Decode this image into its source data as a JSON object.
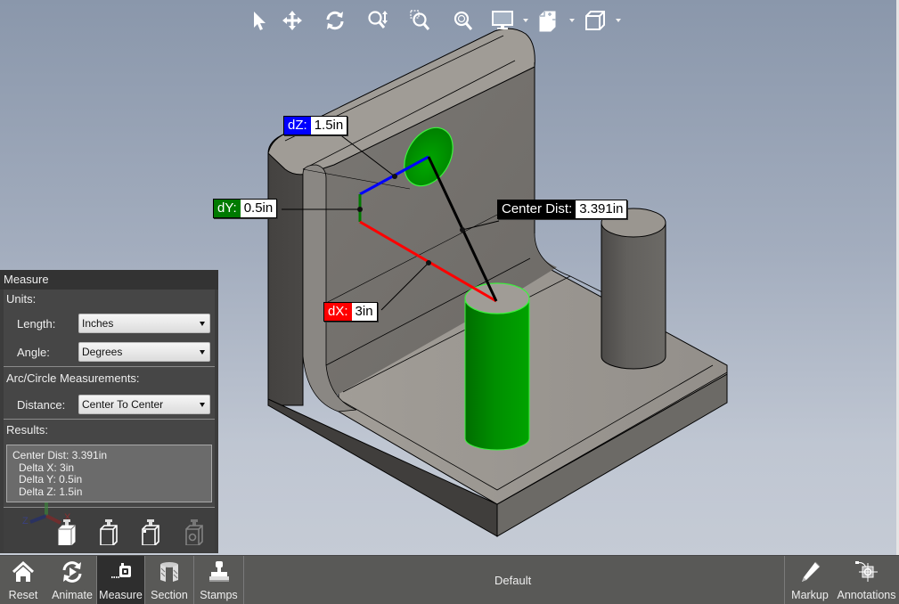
{
  "toolbar": {
    "items": [
      {
        "name": "select-tool",
        "icon": "cursor-arrow-icon"
      },
      {
        "name": "pan-tool",
        "icon": "move-arrows-icon"
      },
      {
        "name": "rotate-tool",
        "icon": "rotate-icon"
      },
      {
        "name": "zoom-tool",
        "icon": "zoom-updown-icon"
      },
      {
        "name": "zoom-window-tool",
        "icon": "zoom-window-icon"
      },
      {
        "name": "zoom-fit-tool",
        "icon": "zoom-fit-icon"
      },
      {
        "name": "display-mode-dropdown",
        "icon": "monitor-icon",
        "has_dropdown": true
      },
      {
        "name": "explode-dropdown",
        "icon": "explode-cube-icon",
        "has_dropdown": true
      },
      {
        "name": "view-orientation-dropdown",
        "icon": "cube-icon",
        "has_dropdown": true
      }
    ]
  },
  "measurements": {
    "dz": {
      "label": "dZ:",
      "value": "1.5in",
      "color": "#0000ff"
    },
    "dy": {
      "label": "dY:",
      "value": "0.5in",
      "color": "#007a00"
    },
    "dx": {
      "label": "dX:",
      "value": "3in",
      "color": "#ff0000"
    },
    "center_dist": {
      "label": "Center Dist:",
      "value": "3.391in",
      "color": "#000000"
    }
  },
  "measure_panel": {
    "title": "Measure",
    "units": {
      "title": "Units:",
      "length_label": "Length:",
      "length_value": "Inches",
      "angle_label": "Angle:",
      "angle_value": "Degrees"
    },
    "arc": {
      "title": "Arc/Circle Measurements:",
      "distance_label": "Distance:",
      "distance_value": "Center To Center"
    },
    "results": {
      "title": "Results:",
      "lines": [
        "Center Dist: 3.391in",
        "Delta X: 3in",
        "Delta Y: 0.5in",
        "Delta Z: 1.5in"
      ]
    },
    "triad": {
      "x": "X",
      "y": "Y",
      "z": "Z"
    }
  },
  "bottom_bar": {
    "left": [
      {
        "label": "Reset",
        "icon": "home-icon"
      },
      {
        "label": "Animate",
        "icon": "animate-icon"
      },
      {
        "label": "Measure",
        "icon": "tape-measure-icon",
        "active": true
      },
      {
        "label": "Section",
        "icon": "section-icon"
      },
      {
        "label": "Stamps",
        "icon": "stamp-icon"
      }
    ],
    "view_name": "Default",
    "right": [
      {
        "label": "Markup",
        "icon": "pencil-icon"
      },
      {
        "label": "Annotations",
        "icon": "annotation-target-icon"
      }
    ]
  },
  "colors": {
    "highlight_green": "#00a000",
    "part_face": "#8f8c88",
    "panel_bg": "#3c3c3c",
    "toolbar_bg": "#595957"
  }
}
